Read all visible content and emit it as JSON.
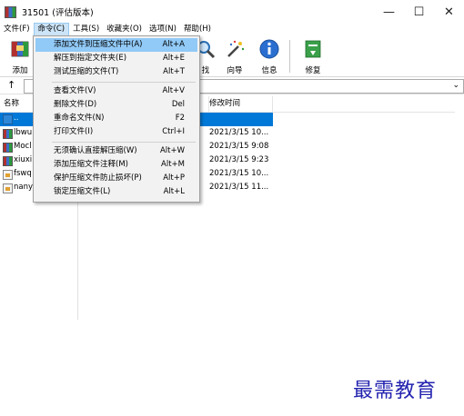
{
  "window": {
    "title": "31501 (评估版本)",
    "controls": {
      "minimize": "—",
      "maximize": "☐",
      "close": "✕"
    }
  },
  "menubar": [
    {
      "label": "文件(F)",
      "active": false
    },
    {
      "label": "命令(C)",
      "active": true
    },
    {
      "label": "工具(S)",
      "active": false
    },
    {
      "label": "收藏夹(O)",
      "active": false
    },
    {
      "label": "选项(N)",
      "active": false
    },
    {
      "label": "帮助(H)",
      "active": false
    }
  ],
  "toolbar": {
    "add_label": "添加",
    "find_label": "找",
    "wizard_label": "向导",
    "info_label": "信息",
    "repair_label": "修复"
  },
  "columns": {
    "name": "名称",
    "modified": "修改时间"
  },
  "files": [
    {
      "name": "..",
      "date": "",
      "icon": "folder-icon",
      "selected": true
    },
    {
      "name": "lbwu",
      "date": "2021/3/15 10...",
      "icon": "rar-icon",
      "selected": false
    },
    {
      "name": "Mocl",
      "date": "2021/3/15 9:08",
      "icon": "rar-icon",
      "selected": false
    },
    {
      "name": "xiuxi",
      "date": "2021/3/15 9:23",
      "icon": "rar-icon",
      "selected": false
    },
    {
      "name": "fswq",
      "date": "2021/3/15 10...",
      "icon": "document-icon",
      "selected": false
    },
    {
      "name": "nany",
      "date": "2021/3/15 11...",
      "icon": "document-icon",
      "selected": false
    }
  ],
  "command_menu": [
    {
      "label": "添加文件到压缩文件中(A)",
      "shortcut": "Alt+A",
      "highlighted": true
    },
    {
      "label": "解压到指定文件夹(E)",
      "shortcut": "Alt+E",
      "highlighted": false
    },
    {
      "label": "测试压缩的文件(T)",
      "shortcut": "Alt+T",
      "highlighted": false
    },
    {
      "label": "查看文件(V)",
      "shortcut": "Alt+V",
      "highlighted": false
    },
    {
      "label": "删除文件(D)",
      "shortcut": "Del",
      "highlighted": false
    },
    {
      "label": "重命名文件(N)",
      "shortcut": "F2",
      "highlighted": false
    },
    {
      "label": "打印文件(I)",
      "shortcut": "Ctrl+I",
      "highlighted": false
    },
    {
      "label": "无须确认直接解压缩(W)",
      "shortcut": "Alt+W",
      "highlighted": false
    },
    {
      "label": "添加压缩文件注释(M)",
      "shortcut": "Alt+M",
      "highlighted": false
    },
    {
      "label": "保护压缩文件防止损坏(P)",
      "shortcut": "Alt+P",
      "highlighted": false
    },
    {
      "label": "锁定压缩文件(L)",
      "shortcut": "Alt+L",
      "highlighted": false
    }
  ],
  "watermark": {
    "text": "最需教育"
  },
  "colors": {
    "selection": "#0078d7",
    "menu_highlight": "#91c9f7",
    "watermark": "#2424b0"
  }
}
